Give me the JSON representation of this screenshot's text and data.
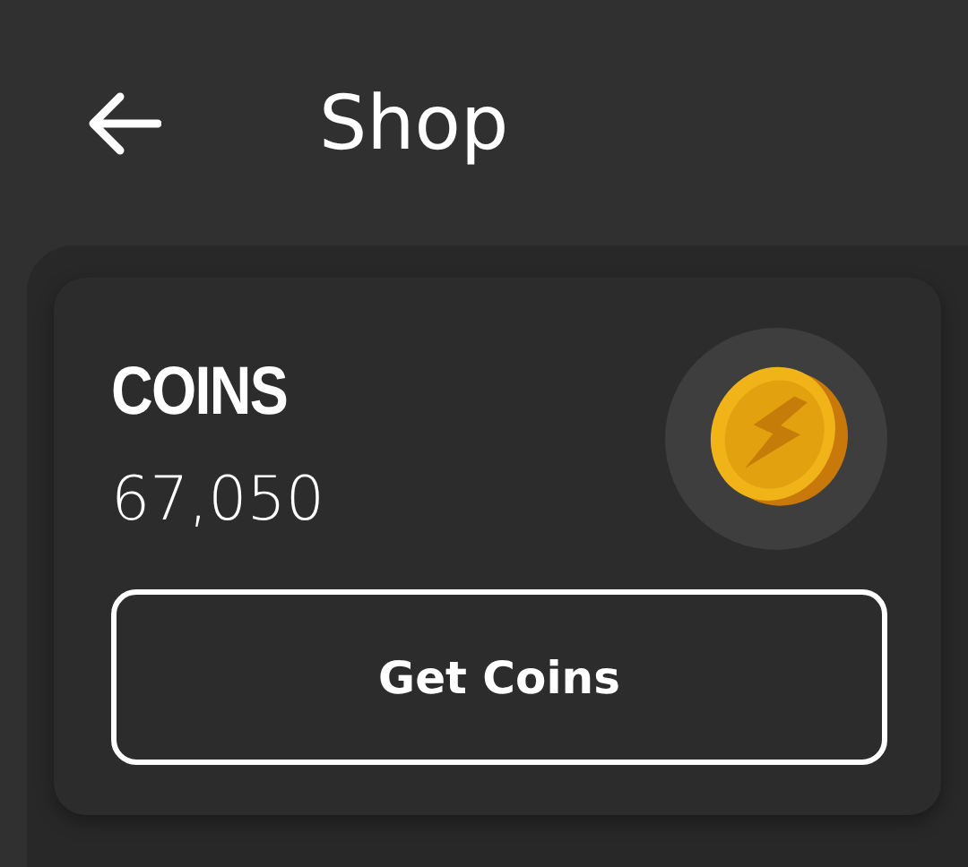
{
  "header": {
    "title": "Shop"
  },
  "wallet": {
    "title": "COINS",
    "balance": "67,050",
    "button": "Get Coins"
  }
}
